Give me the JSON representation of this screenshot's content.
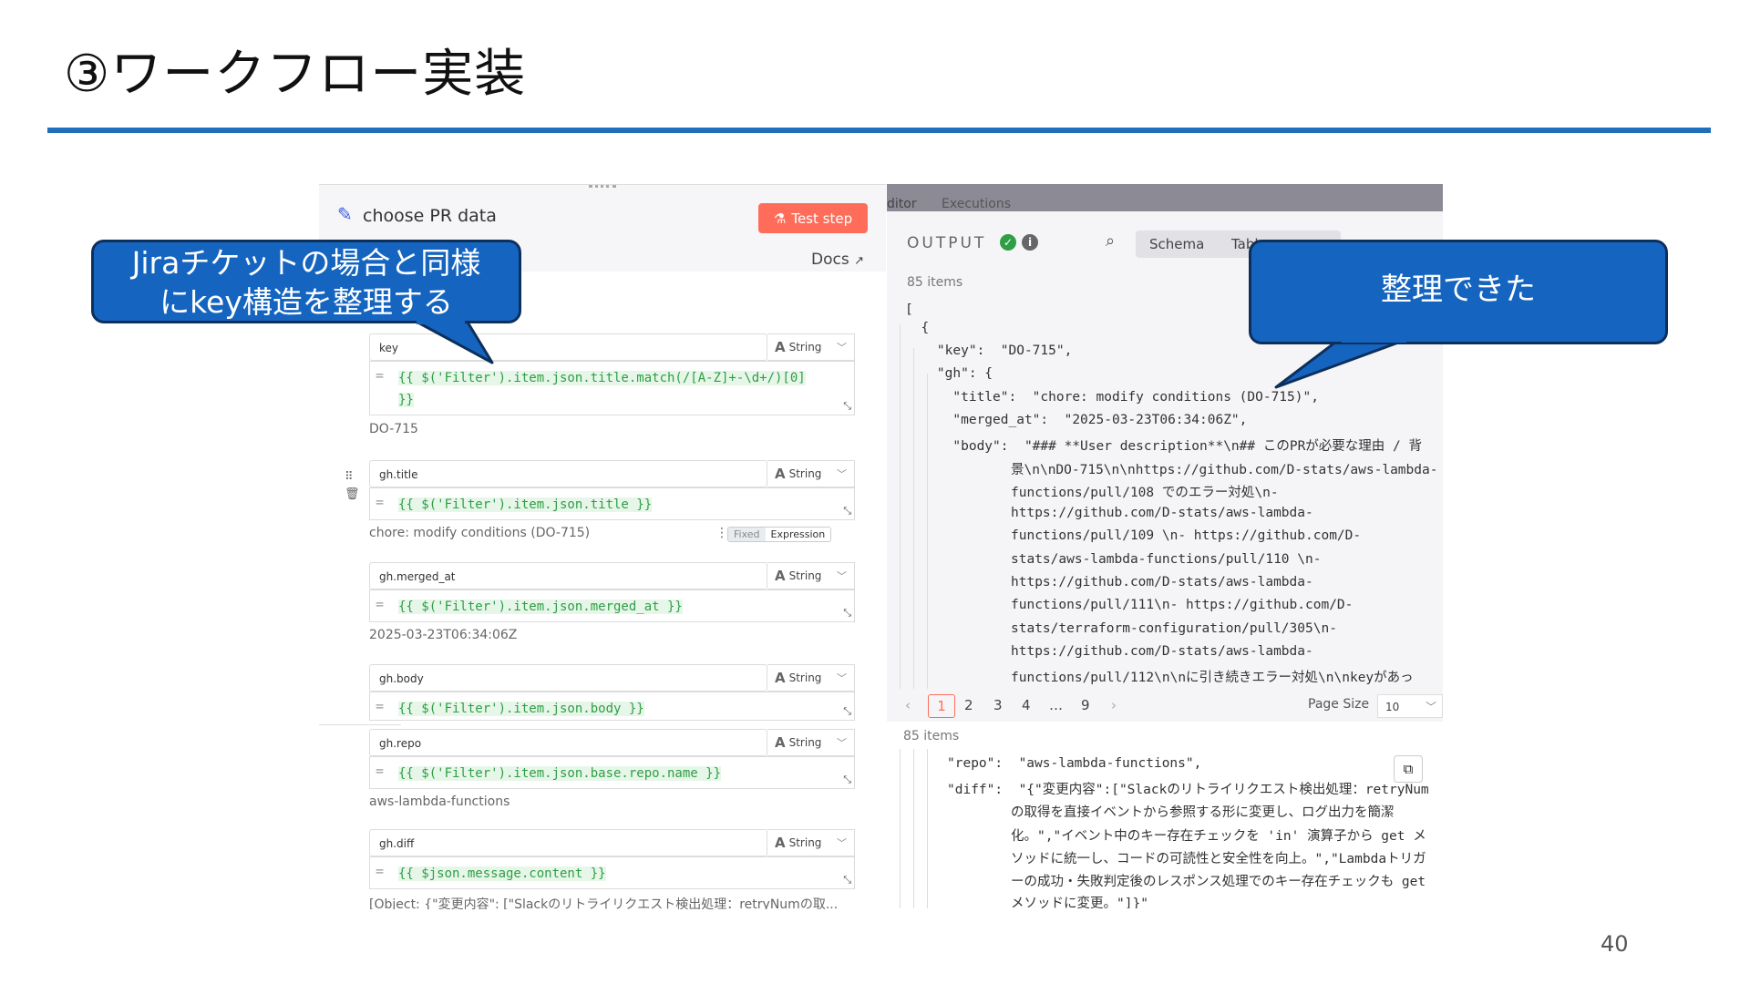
{
  "slide": {
    "title": "③ワークフロー実装",
    "page_number": "40"
  },
  "callouts": {
    "left": {
      "line1": "Jiraチケットの場合と同様",
      "line2": "にkey構造を整理する"
    },
    "right": {
      "text": "整理できた"
    }
  },
  "node": {
    "title": "choose PR data",
    "test_step_label": "Test step",
    "docs_label": "Docs",
    "fields": [
      {
        "name": "key",
        "type": "String",
        "expr_line1": "{{ $('Filter').item.json.title.match(/[A-Z]+-\\d+/)[0]",
        "expr_line2": "}}",
        "result": "DO-715"
      },
      {
        "name": "gh.title",
        "type": "String",
        "expr_line1": "{{ $('Filter').item.json.title }}",
        "result": "chore: modify conditions (DO-715)"
      },
      {
        "name": "gh.merged_at",
        "type": "String",
        "expr_line1": "{{ $('Filter').item.json.merged_at }}",
        "result": "2025-03-23T06:34:06Z"
      },
      {
        "name": "gh.body",
        "type": "String",
        "expr_line1": "{{ $('Filter').item.json.body }}",
        "result": ""
      },
      {
        "name": "gh.repo",
        "type": "String",
        "expr_line1": "{{ $('Filter').item.json.base.repo.name }}",
        "result": "aws-lambda-functions"
      },
      {
        "name": "gh.diff",
        "type": "String",
        "expr_line1": "{{ $json.message.content }}",
        "result": "[Object: {\"変更内容\": [\"Slackのリトライリクエスト検出処理：retryNumの取..."
      }
    ],
    "mode_toggle": {
      "fixed": "Fixed",
      "expression": "Expression"
    }
  },
  "output": {
    "tabs": {
      "editor": "ditor",
      "executions": "Executions"
    },
    "label": "OUTPUT",
    "view_tabs": {
      "schema": "Schema",
      "table": "Tabl"
    },
    "items_count": "85 items",
    "json_lines": [
      "[",
      "  {",
      "    \"key\":  \"DO-715\",",
      "    \"gh\": {",
      "      \"title\":  \"chore: modify conditions (DO-715)\",",
      "      \"merged_at\":  \"2025-03-23T06:34:06Z\",",
      "      \"body\":  \"### **User description**\\n## このPRが必要な理由 / 背",
      "景\\n\\nDO-715\\n\\nhttps://github.com/D-stats/aws-lambda-",
      "functions/pull/108 でのエラー対処\\n-",
      "https://github.com/D-stats/aws-lambda-",
      "functions/pull/109 \\n- https://github.com/D-",
      "stats/aws-lambda-functions/pull/110 \\n-",
      "https://github.com/D-stats/aws-lambda-",
      "functions/pull/111\\n- https://github.com/D-",
      "stats/terraform-configuration/pull/305\\n-",
      "https://github.com/D-stats/aws-lambda-",
      "functions/pull/112\\n\\nに引き続きエラー対処\\n\\nkeyがあっ"
    ],
    "pagination": {
      "pages": [
        "1",
        "2",
        "3",
        "4",
        "…",
        "9"
      ],
      "page_size_label": "Page Size",
      "page_size_value": "10"
    },
    "lower_lines": [
      "\"repo\":  \"aws-lambda-functions\",",
      "\"diff\":  \"{\"変更内容\":[\"Slackのリトライリクエスト検出処理：retryNum",
      "の取得を直接イベントから参照する形に変更し、ログ出力を簡潔",
      "化。\",\"イベント中のキー存在チェックを 'in' 演算子から get メ",
      "ソッドに統一し、コードの可読性と安全性を向上。\",\"Lambdaトリガ",
      "ーの成功・失敗判定後のレスポンス処理でのキー存在チェックも get",
      "メソッドに変更。\"]}\""
    ]
  },
  "colors": {
    "accent_blue": "#1f6fbd",
    "callout_fill": "#1565c0",
    "n8n_orange": "#ff6d5a",
    "code_green": "#2f9e44"
  }
}
